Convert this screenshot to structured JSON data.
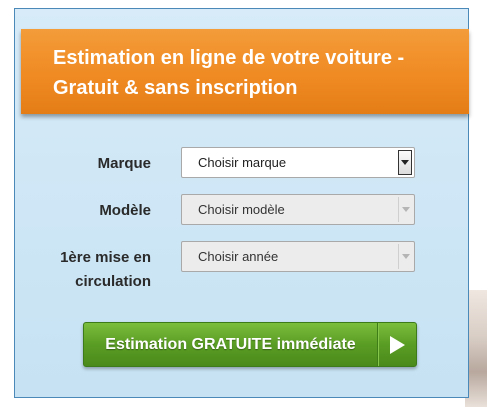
{
  "banner": {
    "line1": "Estimation en ligne de votre voiture -",
    "line2": "Gratuit & sans inscription"
  },
  "form": {
    "brand": {
      "label": "Marque",
      "value": "Choisir marque",
      "enabled": true
    },
    "model": {
      "label": "Modèle",
      "value": "Choisir modèle",
      "enabled": false
    },
    "year": {
      "label_line1": "1ère mise en",
      "label_line2": "circulation",
      "value": "Choisir année",
      "enabled": false
    }
  },
  "cta": {
    "label": "Estimation GRATUITE immédiate"
  },
  "colors": {
    "banner": "#f08a22",
    "panel": "#cfe6f5",
    "cta": "#5a9d24"
  },
  "icons": {
    "dropdown": "chevron-down-icon",
    "cta_arrow": "play-arrow-icon"
  }
}
